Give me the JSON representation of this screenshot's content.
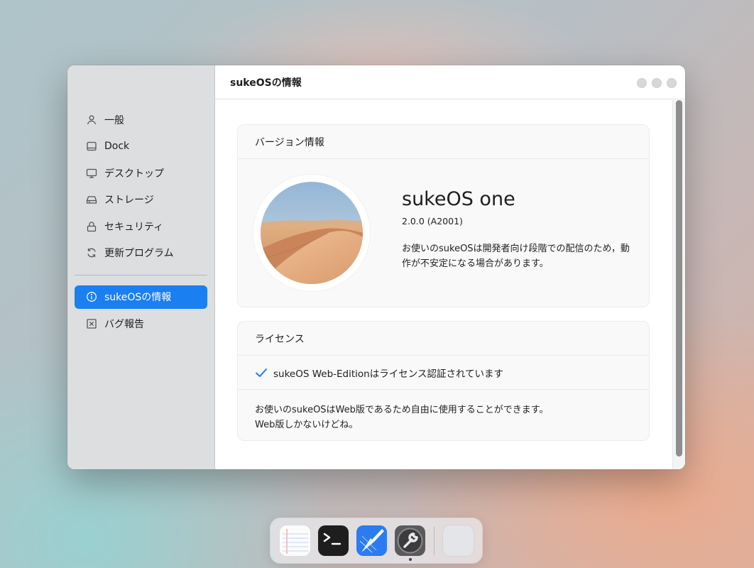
{
  "window": {
    "title": "sukeOSの情報"
  },
  "sidebar": {
    "items": [
      {
        "label": "一般",
        "icon": "user-icon"
      },
      {
        "label": "Dock",
        "icon": "dock-icon"
      },
      {
        "label": "デスクトップ",
        "icon": "monitor-icon"
      },
      {
        "label": "ストレージ",
        "icon": "drive-icon"
      },
      {
        "label": "セキュリティ",
        "icon": "lock-icon"
      },
      {
        "label": "更新プログラム",
        "icon": "refresh-icon"
      }
    ],
    "bottom_items": [
      {
        "label": "sukeOSの情報",
        "icon": "info-icon",
        "active": true
      },
      {
        "label": "バグ報告",
        "icon": "bug-report-icon"
      }
    ]
  },
  "version": {
    "header": "バージョン情報",
    "os_name": "sukeOS one",
    "version": "2.0.0 (A2001)",
    "note": "お使いのsukeOSは開発者向け段階での配信のため，動作が不安定になる場合があります。"
  },
  "license": {
    "header": "ライセンス",
    "status": "sukeOS Web-Editionはライセンス認証されています",
    "desc_line1": "お使いのsukeOSはWeb版であるため自由に使用することができます。",
    "desc_line2": "Web版しかないけどね。"
  },
  "dock": {
    "apps": [
      {
        "icon": "notes-icon"
      },
      {
        "icon": "terminal-icon"
      },
      {
        "icon": "paint-icon"
      },
      {
        "icon": "settings-icon",
        "running": true
      },
      {
        "icon": "blank-app-icon"
      }
    ]
  },
  "colors": {
    "accent": "#1a7ff0",
    "sidebar": "#dcdee0"
  }
}
